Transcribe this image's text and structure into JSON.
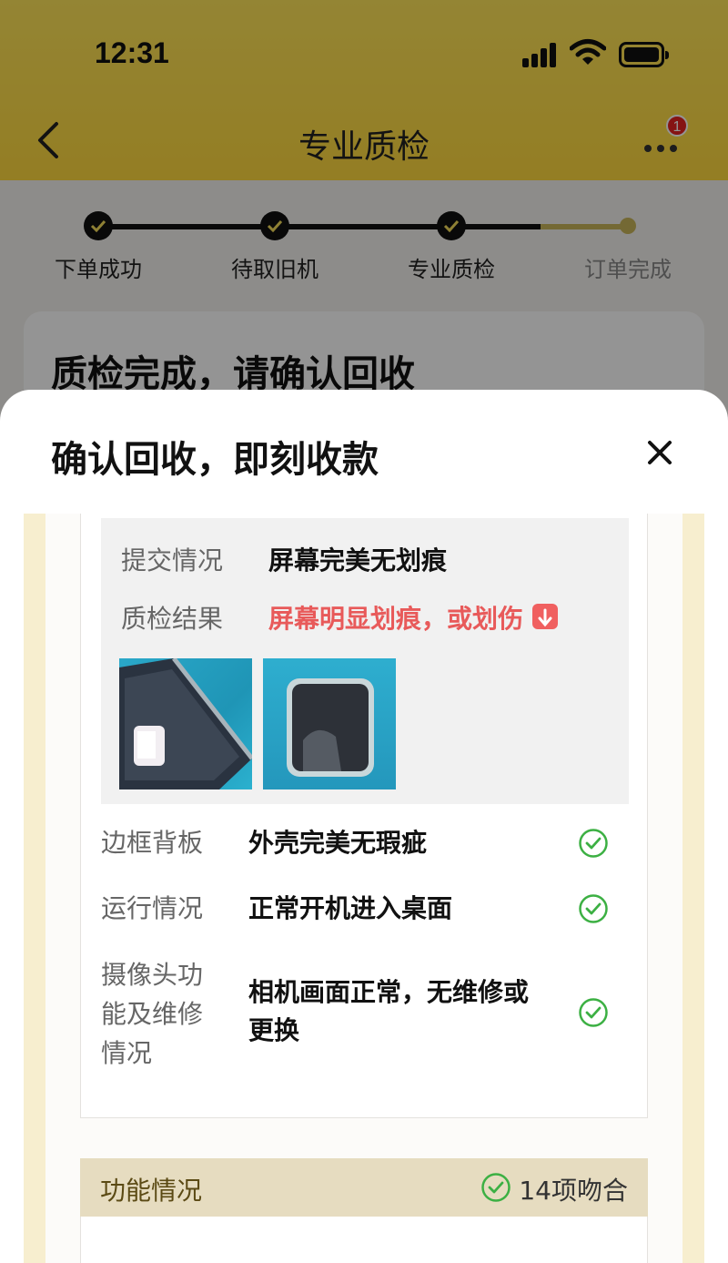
{
  "status_bar": {
    "time": "12:31"
  },
  "nav": {
    "title": "专业质检",
    "badge_count": "1"
  },
  "steps": [
    {
      "label": "下单成功",
      "done": true
    },
    {
      "label": "待取旧机",
      "done": true
    },
    {
      "label": "专业质检",
      "done": true
    },
    {
      "label": "订单完成",
      "done": false
    }
  ],
  "background_card": {
    "title": "质检完成，请确认回收"
  },
  "sheet": {
    "title": "确认回收，即刻收款",
    "screen": {
      "submitted_label": "提交情况",
      "submitted_value": "屏幕完美无划痕",
      "result_label": "质检结果",
      "result_value": "屏幕明显划痕，或划伤"
    },
    "items": [
      {
        "label": "边框背板",
        "value": "外壳完美无瑕疵"
      },
      {
        "label": "运行情况",
        "value": "正常开机进入桌面"
      },
      {
        "label_lines": [
          "摄像头功",
          "能及维修",
          "情况"
        ],
        "value_lines": [
          "相机画面正常，无维修或",
          "更换"
        ]
      }
    ],
    "function": {
      "title": "功能情况",
      "count": "14项吻合"
    }
  },
  "colors": {
    "accent_yellow": "#ffd93e",
    "ok_green": "#3cb043",
    "bad_red": "#e85a5a"
  }
}
